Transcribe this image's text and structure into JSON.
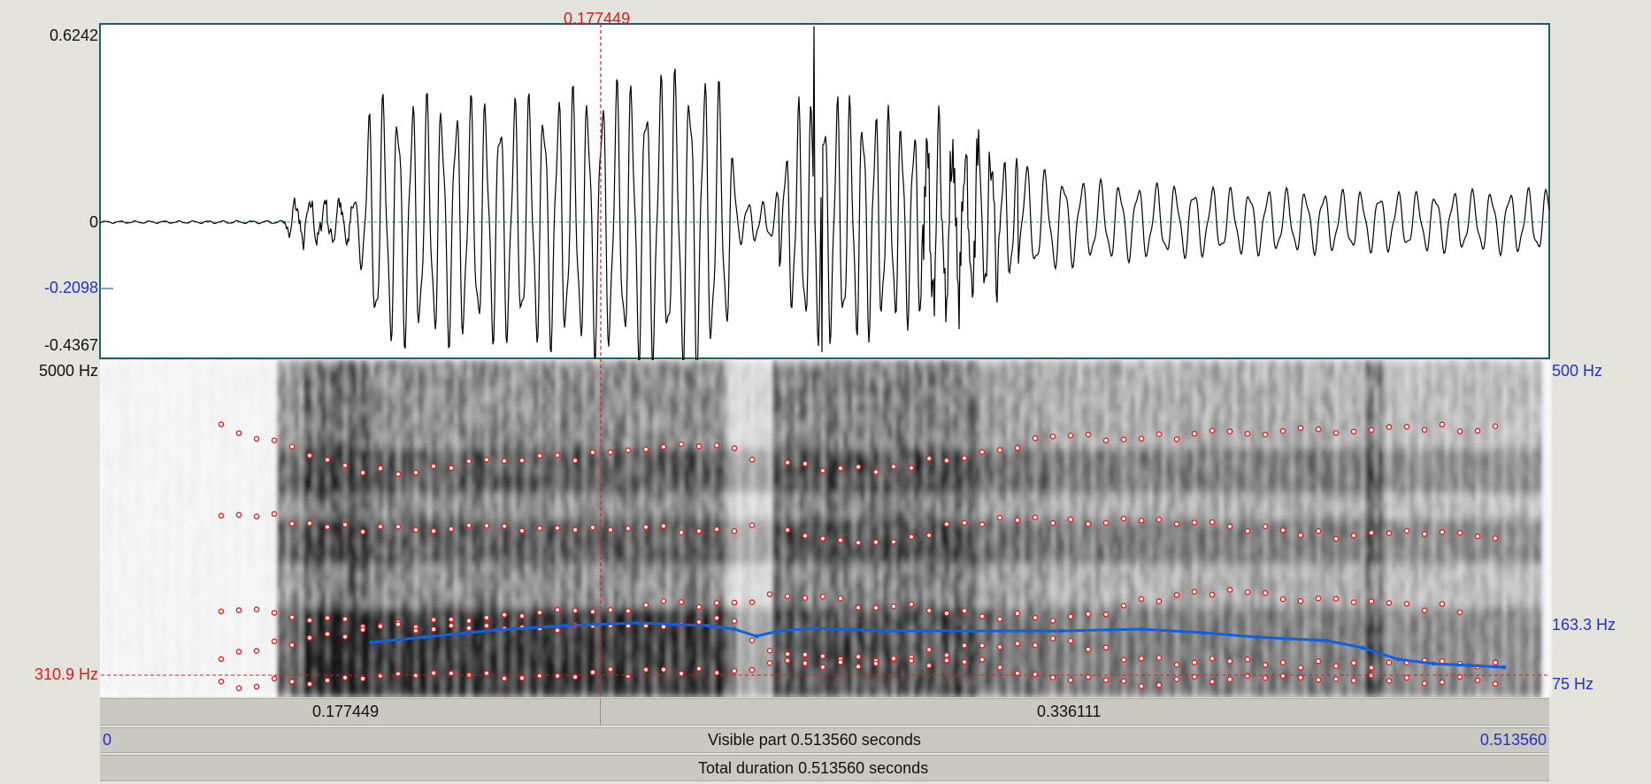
{
  "cursor": {
    "time_label": "0.177449",
    "time": 0.177449
  },
  "waveform": {
    "y_max_label": "0.6242",
    "y_zero_label": "0",
    "y_cursor_label": "-0.2098",
    "y_min_label": "-0.4367",
    "y_max": 0.6242,
    "y_min": -0.4367,
    "y_cursor": -0.2098
  },
  "spectrogram": {
    "freq_max_label": "5000 Hz",
    "freq_cursor_label": "310.9 Hz",
    "pitch_max_label": "500 Hz",
    "pitch_current_label": "163.3 Hz",
    "pitch_min_label": "75 Hz",
    "freq_max": 5000,
    "freq_cursor": 310.9,
    "pitch_max": 500,
    "pitch_min": 75,
    "pitch_current": 163.3
  },
  "selection_bar": {
    "left_label": "0.177449",
    "right_label": "0.336111"
  },
  "visible_bar": {
    "start_label": "0",
    "center_label": "Visible part 0.513560 seconds",
    "end_label": "0.513560"
  },
  "total_bar": {
    "label": "Total duration 0.513560 seconds"
  },
  "colors": {
    "waveform": "#000000",
    "pitch_curve": "#1060e0",
    "formant_dots": "#e02020",
    "cursor": "#d42020",
    "frame": "#1d5f6c"
  },
  "duration": 0.51356
}
